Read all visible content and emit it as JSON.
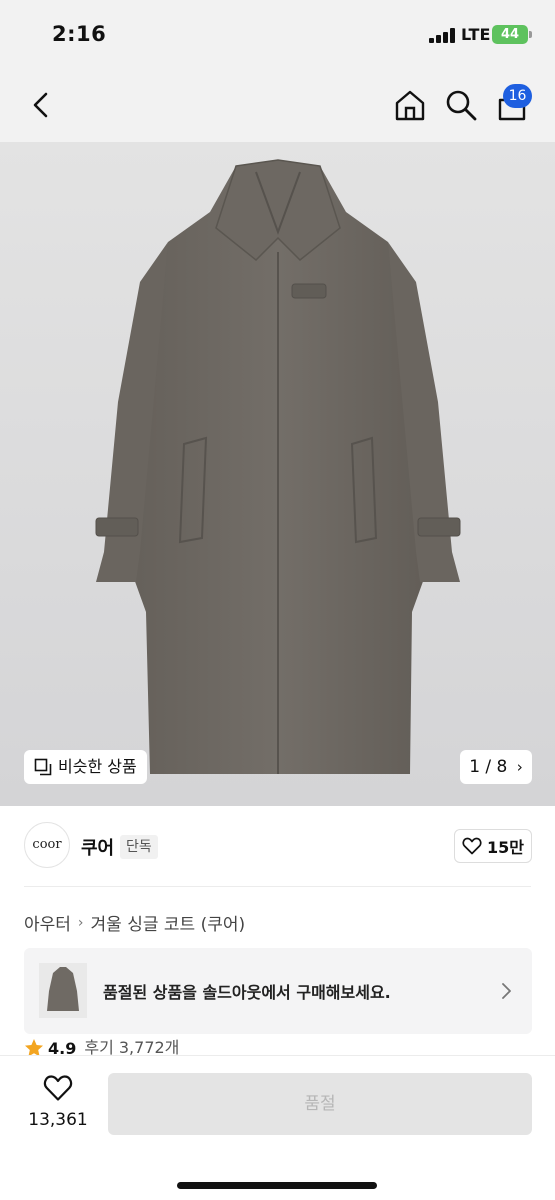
{
  "status_bar": {
    "time": "2:16",
    "network": "LTE",
    "battery": "44"
  },
  "nav": {
    "cart_badge": "16",
    "icons": [
      "chevron-left-icon",
      "home-icon",
      "search-icon",
      "cart-icon"
    ]
  },
  "gallery": {
    "similar_label": "비슷한 상품",
    "pager": "1 / 8"
  },
  "brand": {
    "logo_text": "coor",
    "name": "쿠어",
    "tag": "단독",
    "likes": "15만"
  },
  "breadcrumb": {
    "category": "아우터",
    "product": "겨울 싱글 코트 (쿠어)"
  },
  "soldout": {
    "message": "품절된 상품을 솔드아웃에서 구매해보세요."
  },
  "rating": {
    "score": "4.9",
    "reviews": "후기 3,772개"
  },
  "bottom": {
    "wish_count": "13,361",
    "buy_label": "품절"
  },
  "colors": {
    "badge": "#1e5fe0",
    "star": "#f3a521",
    "battery": "#5ec25e",
    "coat": "#6f6a64"
  }
}
